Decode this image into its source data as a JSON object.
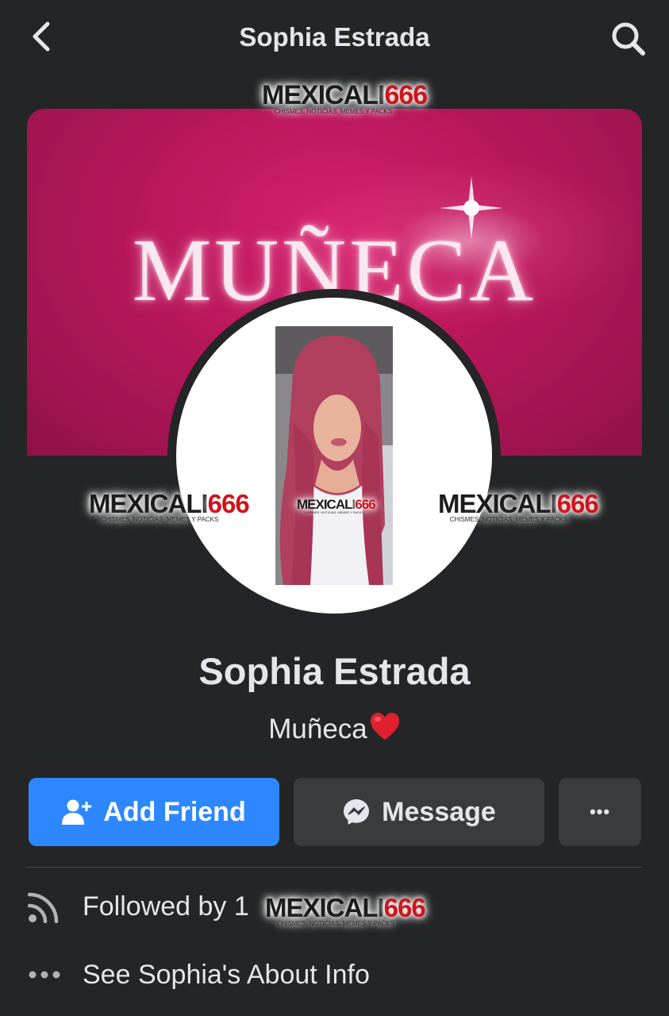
{
  "header": {
    "title": "Sophia Estrada",
    "back_icon": "chevron-left-icon",
    "search_icon": "search-icon"
  },
  "cover": {
    "text": "MUÑECA",
    "color": "#b8175a"
  },
  "profile": {
    "name": "Sophia Estrada",
    "bio": "Muñeca"
  },
  "actions": {
    "add_friend_label": "Add Friend",
    "message_label": "Message",
    "more_label": "•••",
    "accent": "#2d88ff"
  },
  "info": {
    "followers_text": "Followed by 1",
    "about_text": "See Sophia's About Info"
  },
  "watermark": {
    "brand_a": "MEXICALI",
    "brand_b": "666",
    "tagline": "CHISMES, NOTICIAS, MEMES Y PACKS"
  }
}
